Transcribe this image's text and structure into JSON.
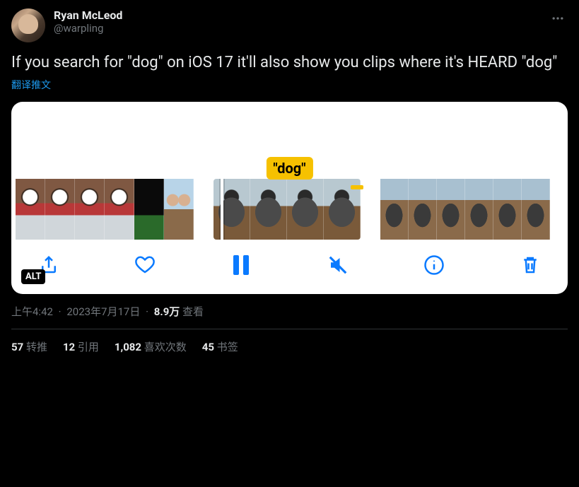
{
  "user": {
    "display_name": "Ryan McLeod",
    "handle": "@warpling"
  },
  "tweet_text": "If you search for \"dog\" on iOS 17 it'll also show you clips where it's HEARD \"dog\"",
  "translate_label": "翻译推文",
  "media": {
    "search_term_badge": "\"dog\"",
    "alt_badge": "ALT"
  },
  "meta": {
    "time": "上午4:42",
    "date": "2023年7月17日",
    "views_count": "8.9万",
    "views_label": " 查看"
  },
  "stats": {
    "retweets_count": "57",
    "retweets_label": " 转推",
    "quotes_count": "12",
    "quotes_label": " 引用",
    "likes_count": "1,082",
    "likes_label": " 喜欢次数",
    "bookmarks_count": "45",
    "bookmarks_label": " 书签"
  }
}
